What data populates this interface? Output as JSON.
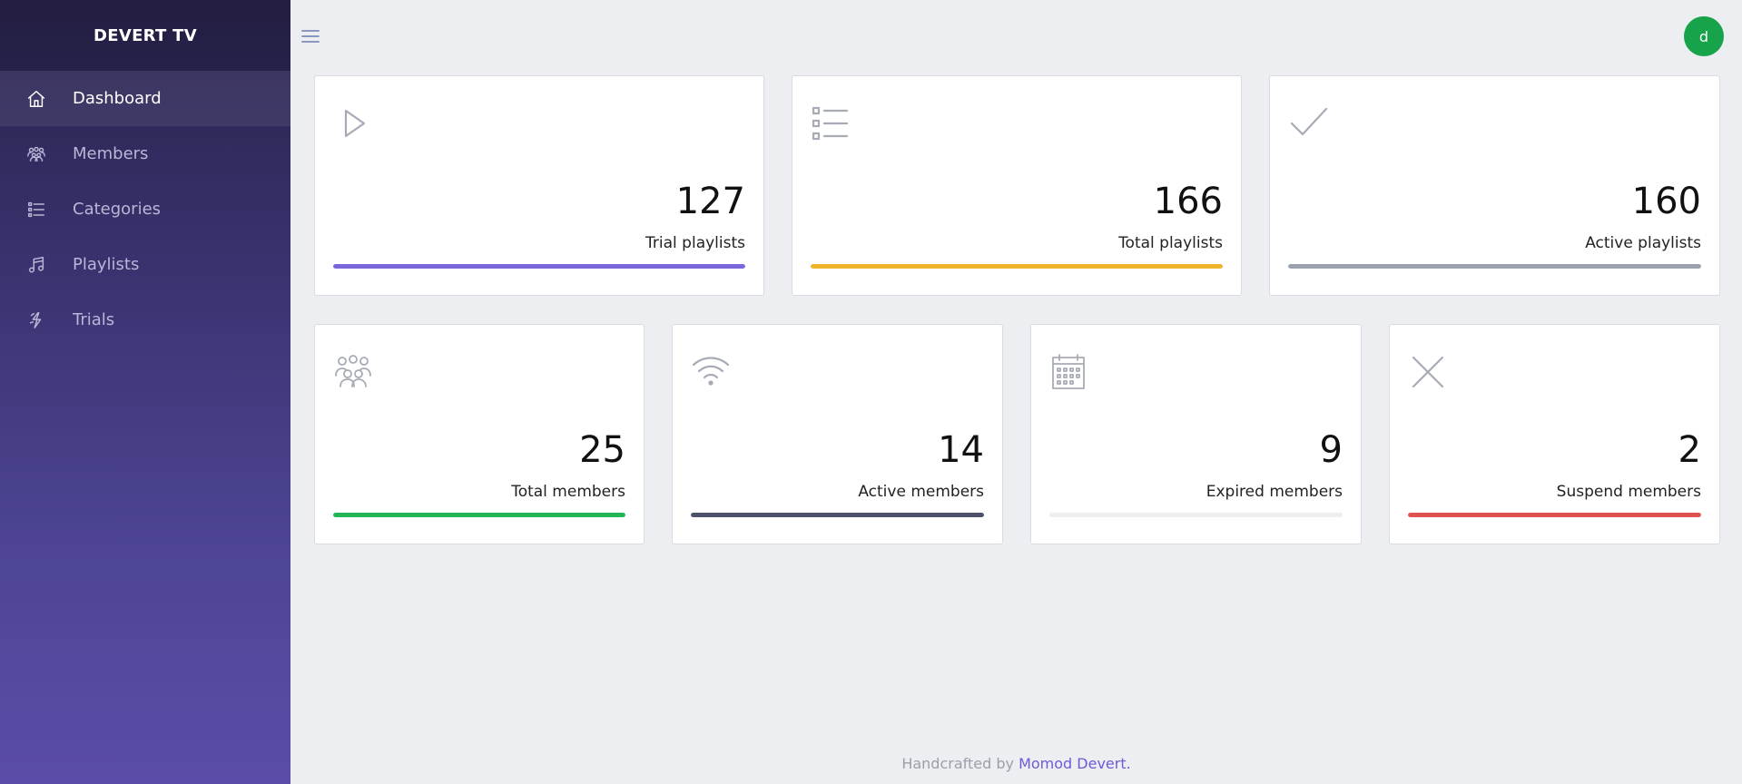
{
  "brand": {
    "title": "DEVERT TV"
  },
  "sidebar": {
    "items": [
      {
        "label": "Dashboard",
        "icon": "home-icon",
        "active": true
      },
      {
        "label": "Members",
        "icon": "members-icon"
      },
      {
        "label": "Categories",
        "icon": "list-icon"
      },
      {
        "label": "Playlists",
        "icon": "music-icon"
      },
      {
        "label": "Trials",
        "icon": "trials-icon"
      }
    ]
  },
  "topbar": {
    "avatar_initial": "d",
    "avatar_color": "#16a34a"
  },
  "stats": [
    {
      "value": "127",
      "label": "Trial playlists",
      "icon": "play-icon",
      "bar_color": "#7c66db",
      "bar_percent": 100
    },
    {
      "value": "166",
      "label": "Total playlists",
      "icon": "list-icon",
      "bar_color": "#f0b429",
      "bar_percent": 100
    },
    {
      "value": "160",
      "label": "Active playlists",
      "icon": "check-icon",
      "bar_color": "#9ca3af",
      "bar_percent": 100
    },
    {
      "value": "25",
      "label": "Total members",
      "icon": "members-icon",
      "bar_color": "#22b557",
      "bar_percent": 100
    },
    {
      "value": "14",
      "label": "Active members",
      "icon": "wifi-icon",
      "bar_color": "#4a5169",
      "bar_percent": 100
    },
    {
      "value": "9",
      "label": "Expired members",
      "icon": "calendar-icon",
      "bar_color": "#eeeeee",
      "bar_percent": 100
    },
    {
      "value": "2",
      "label": "Suspend members",
      "icon": "close-icon",
      "bar_color": "#e05252",
      "bar_percent": 100
    }
  ],
  "footer": {
    "prefix": "Handcrafted by",
    "author": "Momod Devert."
  }
}
